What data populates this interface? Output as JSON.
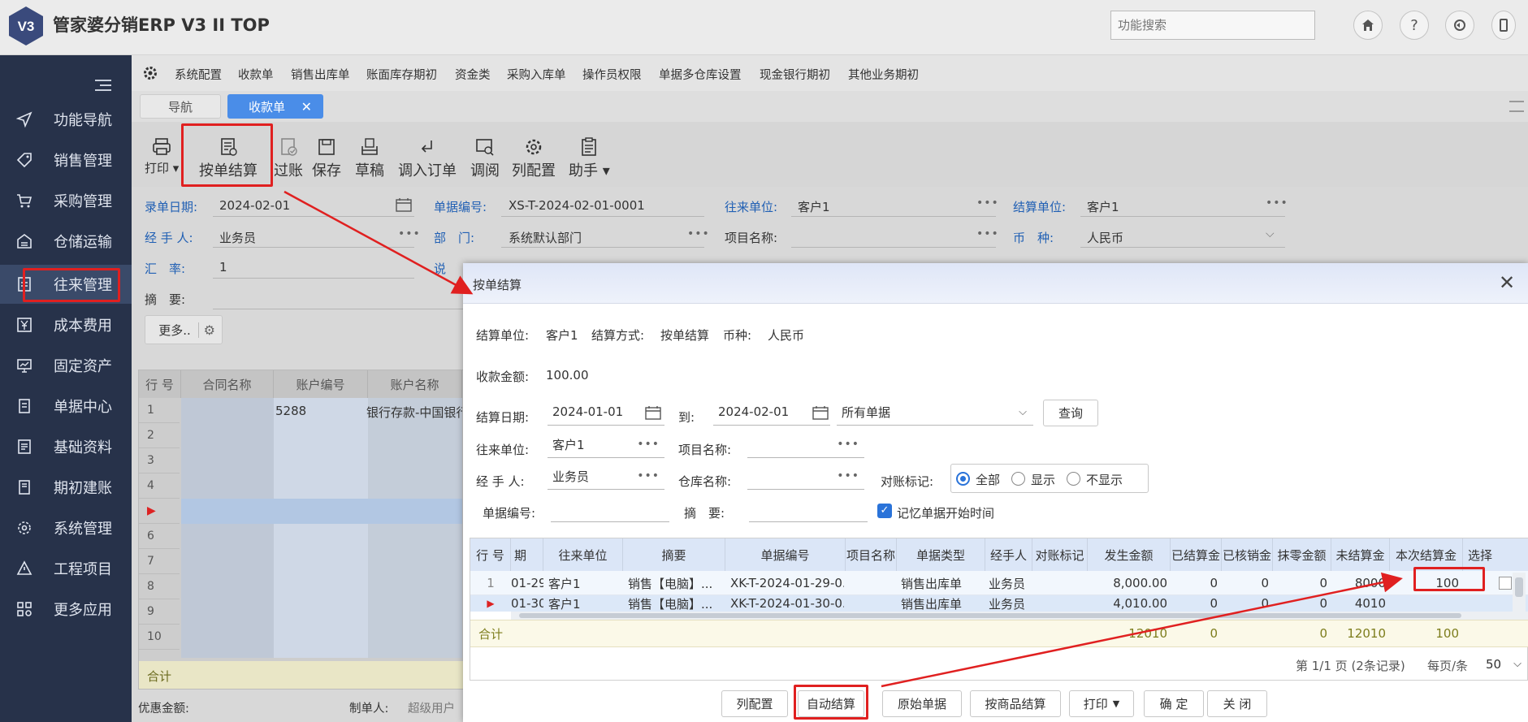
{
  "app": {
    "logo_text": "V3",
    "title": "管家婆分销ERP V3 II TOP",
    "search_placeholder": "功能搜索"
  },
  "sidebar": {
    "items": [
      {
        "label": "功能导航",
        "icon": "send-icon"
      },
      {
        "label": "销售管理",
        "icon": "tag-icon"
      },
      {
        "label": "采购管理",
        "icon": "cart-icon"
      },
      {
        "label": "仓储运输",
        "icon": "warehouse-icon"
      },
      {
        "label": "往来管理",
        "icon": "exchange-icon"
      },
      {
        "label": "成本费用",
        "icon": "yen-icon"
      },
      {
        "label": "固定资产",
        "icon": "monitor-icon"
      },
      {
        "label": "单据中心",
        "icon": "document-icon"
      },
      {
        "label": "基础资料",
        "icon": "list-icon"
      },
      {
        "label": "期初建账",
        "icon": "book-icon"
      },
      {
        "label": "系统管理",
        "icon": "gear-icon"
      },
      {
        "label": "工程项目",
        "icon": "warning-icon"
      },
      {
        "label": "更多应用",
        "icon": "grid-icon"
      }
    ]
  },
  "menubar": {
    "items": [
      "系统配置",
      "收款单",
      "销售出库单",
      "账面库存期初",
      "资金类",
      "采购入库单",
      "操作员权限",
      "单据多仓库设置",
      "现金银行期初",
      "其他业务期初"
    ]
  },
  "tabs": {
    "nav": "导航",
    "active": "收款单"
  },
  "toolbar": {
    "print": "打印",
    "settle_by_bill": "按单结算",
    "post": "过账",
    "save": "保存",
    "draft": "草稿",
    "import_order": "调入订单",
    "review": "调阅",
    "column_config": "列配置",
    "assistant": "助手"
  },
  "form": {
    "date_label": "录单日期:",
    "date_value": "2024-02-01",
    "bill_no_label": "单据编号:",
    "bill_no_value": "XS-T-2024-02-01-0001",
    "partner_label": "往来单位:",
    "partner_value": "客户1",
    "settle_unit_label": "结算单位:",
    "settle_unit_value": "客户1",
    "handler_label": "经 手 人:",
    "handler_value": "业务员",
    "dept_label": "部　门:",
    "dept_value": "系统默认部门",
    "project_label": "项目名称:",
    "currency_label": "币　种:",
    "currency_value": "人民币",
    "rate_label": "汇　率:",
    "rate_value": "1",
    "note_label": "说",
    "summary_label": "摘　要:",
    "more_button": "更多.."
  },
  "grid": {
    "headers": [
      "行 号",
      "合同名称",
      "账户编号",
      "账户名称"
    ],
    "rows": [
      {
        "num": "1",
        "account_no": "5288",
        "account_name": "银行存款-中国银行"
      },
      {
        "num": "2"
      },
      {
        "num": "3"
      },
      {
        "num": "4"
      },
      {
        "num": ""
      },
      {
        "num": "6"
      },
      {
        "num": "7"
      },
      {
        "num": "8"
      },
      {
        "num": "9"
      },
      {
        "num": "10"
      }
    ],
    "total_label": "合计"
  },
  "footer": {
    "discount_label": "优惠金额:",
    "maker_label": "制单人:",
    "maker_value": "超级用户"
  },
  "dialog": {
    "title": "按单结算",
    "settle_unit_label": "结算单位:",
    "settle_unit_value": "客户1",
    "settle_method_label": "结算方式:",
    "settle_method_value": "按单结算",
    "currency_label": "币种:",
    "currency_value": "人民币",
    "receipt_label": "收款金额:",
    "receipt_value": "100.00",
    "settle_date_label": "结算日期:",
    "date_from": "2024-01-01",
    "to_label": "到:",
    "date_to": "2024-02-01",
    "bill_filter": "所有单据",
    "query_button": "查询",
    "partner_label": "往来单位:",
    "partner_value": "客户1",
    "project_label": "项目名称:",
    "handler_label": "经 手 人:",
    "handler_value": "业务员",
    "warehouse_label": "仓库名称:",
    "reconcile_label": "对账标记:",
    "radio_all": "全部",
    "radio_show": "显示",
    "radio_hide": "不显示",
    "bill_no_label": "单据编号:",
    "summary_label": "摘　要:",
    "remember_label": "记忆单据开始时间",
    "grid_headers": [
      "行 号",
      "期",
      "往来单位",
      "摘要",
      "单据编号",
      "项目名称",
      "单据类型",
      "经手人",
      "对账标记",
      "发生金额",
      "已结算金",
      "已核销金",
      "抹零金额",
      "未结算金",
      "本次结算金",
      "选择"
    ],
    "rows": [
      {
        "num": "1",
        "date": "01-29",
        "partner": "客户1",
        "summary": "销售【电脑】...",
        "bill_no": "XK-T-2024-01-29-0...",
        "type": "销售出库单",
        "handler": "业务员",
        "amount": "8,000.00",
        "settled": "0",
        "written_off": "0",
        "rounding": "0",
        "unsettled": "8000",
        "this_settle": "100"
      },
      {
        "num": "",
        "date": "01-30",
        "partner": "客户1",
        "summary": "销售【电脑】...",
        "bill_no": "XK-T-2024-01-30-0...",
        "type": "销售出库单",
        "handler": "业务员",
        "amount": "4,010.00",
        "settled": "0",
        "written_off": "0",
        "rounding": "0",
        "unsettled": "4010",
        "this_settle": ""
      }
    ],
    "total": {
      "label": "合计",
      "amount": "12010",
      "settled": "0",
      "rounding": "0",
      "unsettled": "12010",
      "this_settle": "100"
    },
    "pager": {
      "page_text": "第 1/1 页 (2条记录)",
      "per_page_label": "每页/条",
      "per_page_value": "50"
    },
    "buttons": {
      "column_config": "列配置",
      "auto_settle": "自动结算",
      "original_bill": "原始单据",
      "by_goods": "按商品结算",
      "print": "打印",
      "ok": "确 定",
      "close": "关 闭"
    }
  },
  "colors": {
    "sidebar_bg": "#27324a",
    "active_tab": "#4a8de8",
    "highlight_red": "#e02020",
    "label_blue": "#2160b4"
  }
}
